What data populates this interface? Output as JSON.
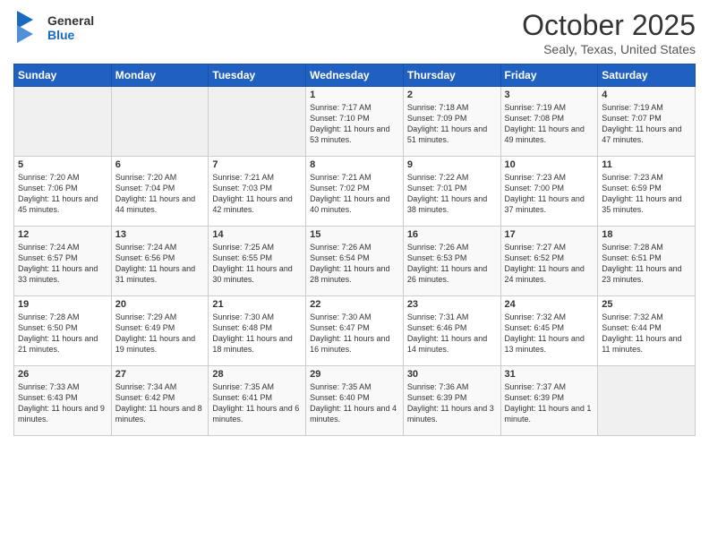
{
  "header": {
    "logo_general": "General",
    "logo_blue": "Blue",
    "month_title": "October 2025",
    "location": "Sealy, Texas, United States"
  },
  "days_of_week": [
    "Sunday",
    "Monday",
    "Tuesday",
    "Wednesday",
    "Thursday",
    "Friday",
    "Saturday"
  ],
  "weeks": [
    [
      {
        "day": "",
        "info": ""
      },
      {
        "day": "",
        "info": ""
      },
      {
        "day": "",
        "info": ""
      },
      {
        "day": "1",
        "info": "Sunrise: 7:17 AM\nSunset: 7:10 PM\nDaylight: 11 hours and 53 minutes."
      },
      {
        "day": "2",
        "info": "Sunrise: 7:18 AM\nSunset: 7:09 PM\nDaylight: 11 hours and 51 minutes."
      },
      {
        "day": "3",
        "info": "Sunrise: 7:19 AM\nSunset: 7:08 PM\nDaylight: 11 hours and 49 minutes."
      },
      {
        "day": "4",
        "info": "Sunrise: 7:19 AM\nSunset: 7:07 PM\nDaylight: 11 hours and 47 minutes."
      }
    ],
    [
      {
        "day": "5",
        "info": "Sunrise: 7:20 AM\nSunset: 7:06 PM\nDaylight: 11 hours and 45 minutes."
      },
      {
        "day": "6",
        "info": "Sunrise: 7:20 AM\nSunset: 7:04 PM\nDaylight: 11 hours and 44 minutes."
      },
      {
        "day": "7",
        "info": "Sunrise: 7:21 AM\nSunset: 7:03 PM\nDaylight: 11 hours and 42 minutes."
      },
      {
        "day": "8",
        "info": "Sunrise: 7:21 AM\nSunset: 7:02 PM\nDaylight: 11 hours and 40 minutes."
      },
      {
        "day": "9",
        "info": "Sunrise: 7:22 AM\nSunset: 7:01 PM\nDaylight: 11 hours and 38 minutes."
      },
      {
        "day": "10",
        "info": "Sunrise: 7:23 AM\nSunset: 7:00 PM\nDaylight: 11 hours and 37 minutes."
      },
      {
        "day": "11",
        "info": "Sunrise: 7:23 AM\nSunset: 6:59 PM\nDaylight: 11 hours and 35 minutes."
      }
    ],
    [
      {
        "day": "12",
        "info": "Sunrise: 7:24 AM\nSunset: 6:57 PM\nDaylight: 11 hours and 33 minutes."
      },
      {
        "day": "13",
        "info": "Sunrise: 7:24 AM\nSunset: 6:56 PM\nDaylight: 11 hours and 31 minutes."
      },
      {
        "day": "14",
        "info": "Sunrise: 7:25 AM\nSunset: 6:55 PM\nDaylight: 11 hours and 30 minutes."
      },
      {
        "day": "15",
        "info": "Sunrise: 7:26 AM\nSunset: 6:54 PM\nDaylight: 11 hours and 28 minutes."
      },
      {
        "day": "16",
        "info": "Sunrise: 7:26 AM\nSunset: 6:53 PM\nDaylight: 11 hours and 26 minutes."
      },
      {
        "day": "17",
        "info": "Sunrise: 7:27 AM\nSunset: 6:52 PM\nDaylight: 11 hours and 24 minutes."
      },
      {
        "day": "18",
        "info": "Sunrise: 7:28 AM\nSunset: 6:51 PM\nDaylight: 11 hours and 23 minutes."
      }
    ],
    [
      {
        "day": "19",
        "info": "Sunrise: 7:28 AM\nSunset: 6:50 PM\nDaylight: 11 hours and 21 minutes."
      },
      {
        "day": "20",
        "info": "Sunrise: 7:29 AM\nSunset: 6:49 PM\nDaylight: 11 hours and 19 minutes."
      },
      {
        "day": "21",
        "info": "Sunrise: 7:30 AM\nSunset: 6:48 PM\nDaylight: 11 hours and 18 minutes."
      },
      {
        "day": "22",
        "info": "Sunrise: 7:30 AM\nSunset: 6:47 PM\nDaylight: 11 hours and 16 minutes."
      },
      {
        "day": "23",
        "info": "Sunrise: 7:31 AM\nSunset: 6:46 PM\nDaylight: 11 hours and 14 minutes."
      },
      {
        "day": "24",
        "info": "Sunrise: 7:32 AM\nSunset: 6:45 PM\nDaylight: 11 hours and 13 minutes."
      },
      {
        "day": "25",
        "info": "Sunrise: 7:32 AM\nSunset: 6:44 PM\nDaylight: 11 hours and 11 minutes."
      }
    ],
    [
      {
        "day": "26",
        "info": "Sunrise: 7:33 AM\nSunset: 6:43 PM\nDaylight: 11 hours and 9 minutes."
      },
      {
        "day": "27",
        "info": "Sunrise: 7:34 AM\nSunset: 6:42 PM\nDaylight: 11 hours and 8 minutes."
      },
      {
        "day": "28",
        "info": "Sunrise: 7:35 AM\nSunset: 6:41 PM\nDaylight: 11 hours and 6 minutes."
      },
      {
        "day": "29",
        "info": "Sunrise: 7:35 AM\nSunset: 6:40 PM\nDaylight: 11 hours and 4 minutes."
      },
      {
        "day": "30",
        "info": "Sunrise: 7:36 AM\nSunset: 6:39 PM\nDaylight: 11 hours and 3 minutes."
      },
      {
        "day": "31",
        "info": "Sunrise: 7:37 AM\nSunset: 6:39 PM\nDaylight: 11 hours and 1 minute."
      },
      {
        "day": "",
        "info": ""
      }
    ]
  ]
}
